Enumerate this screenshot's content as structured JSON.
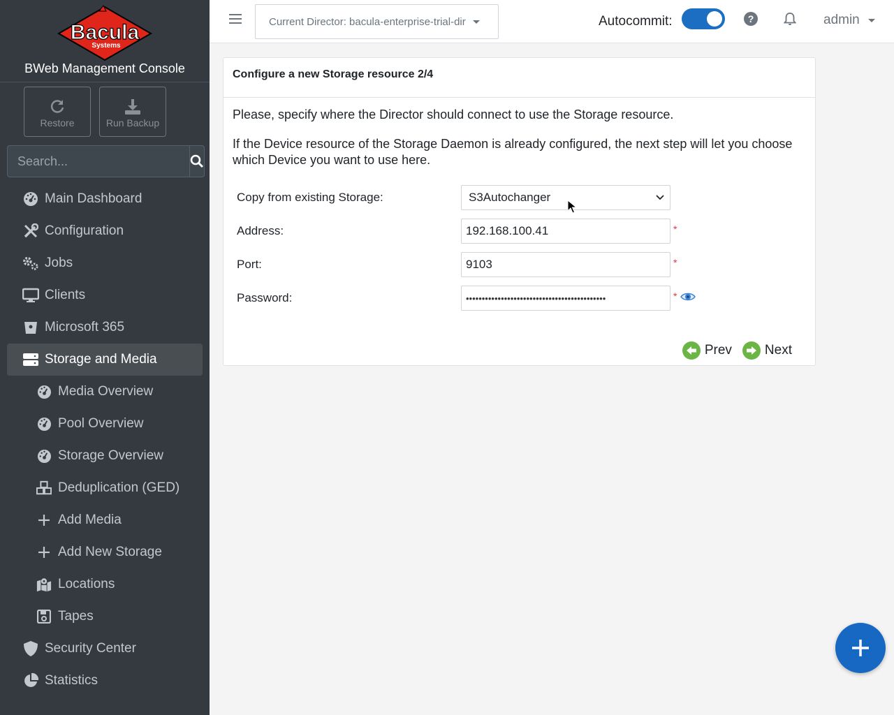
{
  "sidebar": {
    "brand_logo_text": "Bacula",
    "brand_logo_sub": "Systems",
    "brand_title": "BWeb Management Console",
    "quick_buttons": {
      "restore": "Restore",
      "run_backup": "Run Backup"
    },
    "search_placeholder": "Search...",
    "nav": {
      "main_dashboard": "Main Dashboard",
      "configuration": "Configuration",
      "jobs": "Jobs",
      "clients": "Clients",
      "microsoft_365": "Microsoft 365",
      "storage_and_media": "Storage and Media",
      "media_overview": "Media Overview",
      "pool_overview": "Pool Overview",
      "storage_overview": "Storage Overview",
      "deduplication": "Deduplication (GED)",
      "add_media": "Add Media",
      "add_new_storage": "Add New Storage",
      "locations": "Locations",
      "tapes": "Tapes",
      "security_center": "Security Center",
      "statistics": "Statistics"
    }
  },
  "topbar": {
    "director": "Current Director: bacula-enterprise-trial-dir",
    "autocommit_label": "Autocommit:",
    "autocommit_on": true,
    "user": "admin"
  },
  "card": {
    "title": "Configure a new Storage resource 2/4",
    "intro1": "Please, specify where the Director should connect to use the Storage resource.",
    "intro2": "If the Device resource of the Storage Daemon is already configured, the next step will let you choose which Device you want to use here.",
    "fields": {
      "copy_label": "Copy from existing Storage:",
      "copy_value": "S3Autochanger",
      "address_label": "Address:",
      "address_value": "192.168.100.41",
      "port_label": "Port:",
      "port_value": "9103",
      "password_label": "Password:",
      "password_value": "••••••••••••••••••••••••••••••••••••••••••••"
    },
    "required_mark": "*",
    "prev": "Prev",
    "next": "Next"
  },
  "colors": {
    "sidebar_bg": "#343a40",
    "accent": "#1b6ec2",
    "wizard_green": "#6bb544",
    "fab": "#1668c2"
  }
}
